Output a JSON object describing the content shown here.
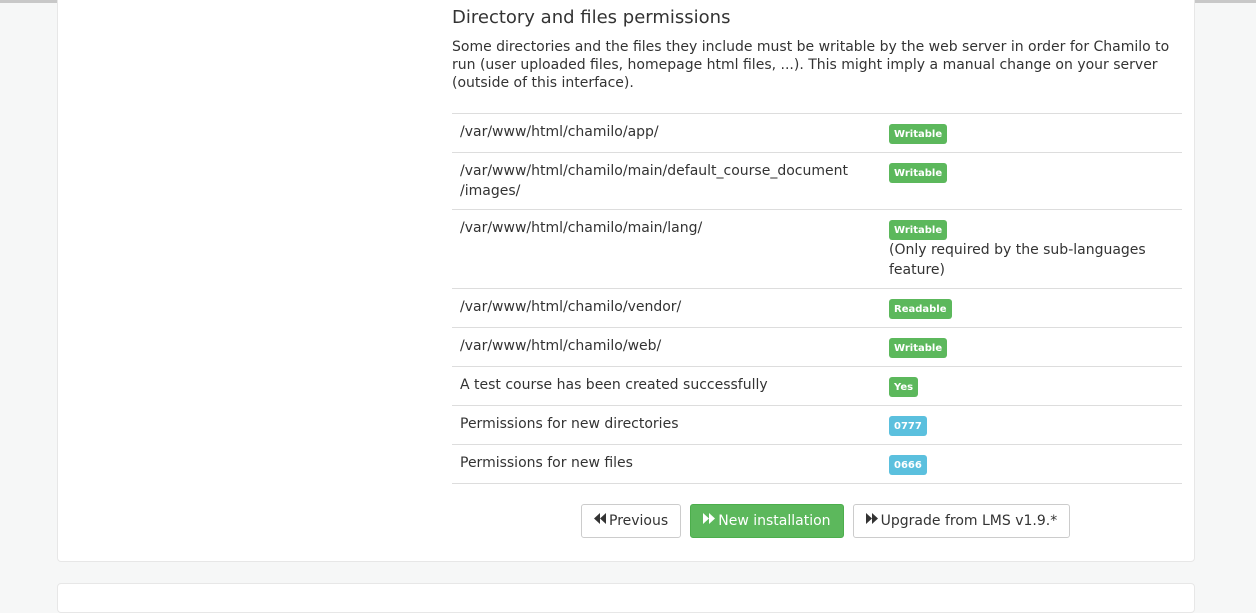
{
  "section": {
    "title": "Directory and files permissions",
    "intro": "Some directories and the files they include must be writable by the web server in order for Chamilo to run (user uploaded files, homepage html files, ...). This might imply a manual change on your server (outside of this interface)."
  },
  "rows": [
    {
      "path": "/var/www/html/chamilo/app/",
      "status": "Writable",
      "status_color": "#5cb85c"
    },
    {
      "path": "/var/www/html/chamilo/main/default_course_document/images/",
      "path_line1": "/var/www/html/chamilo/main/default_course_document",
      "path_line2": "/images/",
      "status": "Writable",
      "status_color": "#5cb85c"
    },
    {
      "path": "/var/www/html/chamilo/main/lang/",
      "status": "Writable",
      "status_color": "#5cb85c",
      "note": "(Only required by the sub-languages feature)"
    },
    {
      "path": "/var/www/html/chamilo/vendor/",
      "status": "Readable",
      "status_color": "#5cb85c"
    },
    {
      "path": "/var/www/html/chamilo/web/",
      "status": "Writable",
      "status_color": "#5cb85c"
    },
    {
      "path": "A test course has been created successfully",
      "status": "Yes",
      "status_color": "#5cb85c"
    },
    {
      "path": "Permissions for new directories",
      "status": "0777",
      "status_color": "#5bc0de"
    },
    {
      "path": "Permissions for new files",
      "status": "0666",
      "status_color": "#5bc0de"
    }
  ],
  "buttons": {
    "previous": {
      "label": "Previous",
      "icon": "backward-icon"
    },
    "new_installation": {
      "label": "New installation",
      "icon": "forward-icon"
    },
    "upgrade": {
      "label": "Upgrade from LMS v1.9.*",
      "icon": "forward-icon"
    }
  },
  "colors": {
    "success": "#5cb85c",
    "info": "#5bc0de",
    "panel_border": "#e7e7e7",
    "page_background": "#f6f7f7"
  }
}
